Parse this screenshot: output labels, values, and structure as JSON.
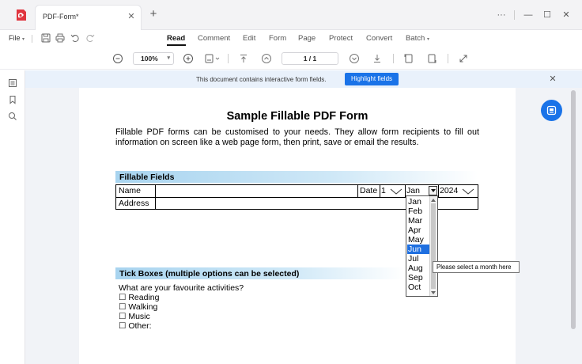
{
  "window": {
    "tab_title": "PDF-Form*",
    "tab_close_icon": "close-icon",
    "new_tab": "+",
    "controls": {
      "more": "···",
      "minimize": "—",
      "maximize": "☐",
      "close": "✕"
    }
  },
  "menubar": {
    "file_label": "File",
    "items": [
      "Read",
      "Comment",
      "Edit",
      "Form",
      "Page",
      "Protect",
      "Convert",
      "Batch"
    ],
    "active": "Read"
  },
  "toolbar": {
    "zoom_value": "100%",
    "page_value": "1 / 1"
  },
  "notification": {
    "message": "This document contains interactive form fields.",
    "button_label": "Highlight fields",
    "close": "✕"
  },
  "document": {
    "title": "Sample Fillable PDF Form",
    "intro": "Fillable PDF forms can be customised to your needs. They allow form recipients to fill out information on screen like a web page form, then print, save or email the results.",
    "fillable_section": {
      "heading": "Fillable Fields",
      "name_label": "Name",
      "date_label": "Date",
      "day_value": "1",
      "month_value": "Jan",
      "year_value": "2024",
      "address_label": "Address"
    },
    "month_dropdown": {
      "options": [
        "Jan",
        "Feb",
        "Mar",
        "Apr",
        "May",
        "Jun",
        "Jul",
        "Aug",
        "Sep",
        "Oct"
      ],
      "highlighted": "Jun",
      "tooltip": "Please select a month here"
    },
    "tick_section": {
      "heading": "Tick Boxes (multiple options can be selected)",
      "question": "What are your favourite activities?",
      "options": [
        "Reading",
        "Walking",
        "Music",
        "Other:"
      ]
    }
  },
  "colors": {
    "accent": "#1a73e8",
    "notify_bg": "#e9f1fb",
    "section_band": "#a8d4ef",
    "selection": "#1e6fe0"
  }
}
